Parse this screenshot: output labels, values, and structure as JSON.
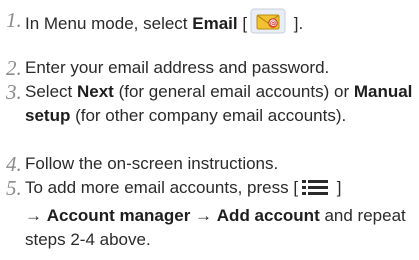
{
  "steps": [
    {
      "number": "1.",
      "parts": {
        "a": "In Menu mode, select ",
        "b_bold": "Email",
        "c": " [",
        "d": " ]."
      },
      "icon": "email-app-icon"
    },
    {
      "number": "2.",
      "text": "Enter your email address and password."
    },
    {
      "number": "3.",
      "parts": {
        "a": "Select ",
        "b_bold": "Next",
        "c": " (for general email accounts) or ",
        "d_bold": "Manual setup",
        "e": " (for other company email accounts)."
      }
    },
    {
      "number": "4.",
      "text": "Follow the on-screen instructions."
    },
    {
      "number": "5.",
      "parts": {
        "a": "To add more email accounts, press [",
        "b": " ]",
        "c": "→ ",
        "d_bold": "Account manager",
        "e": " → ",
        "f_bold": "Add account",
        "g": " and repeat steps 2-4 above."
      },
      "icon": "menu-key-icon"
    }
  ],
  "colors": {
    "text": "#2a2a2a",
    "number": "#8c8c8c",
    "envelope": "#f2c230",
    "badge": "#d03a2a"
  }
}
